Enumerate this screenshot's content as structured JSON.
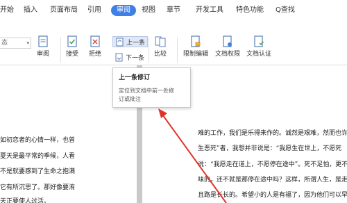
{
  "menu": {
    "items": [
      "开始",
      "插入",
      "页面布局",
      "引用",
      "审阅",
      "视图",
      "章节",
      "开发工具",
      "特色功能"
    ],
    "active": "审阅",
    "search_label": "Q查找"
  },
  "ribbon": {
    "combo_text": "态",
    "review_label": "审阅",
    "accept_label": "接受",
    "reject_label": "拒绝",
    "prev_label": "上一条",
    "next_label": "下一条",
    "compare_label": "比较",
    "restrict_label": "限制编辑",
    "permission_label": "文档权限",
    "certify_label": "文档认证"
  },
  "tooltip": {
    "title": "上一条修订",
    "description_line1": "定位到文档中前一处修",
    "description_line2": "订或批注"
  },
  "document": {
    "left_lines": [
      "如初恋者的心情一样，也曾",
      "夏天是最平常的季候，人看",
      "不是就要感到了生命之抱满",
      "它有所沉思了。那好像要洧",
      "天正要使人过活。"
    ],
    "right_lines": [
      "难的工作，我们是乐得来作的。诚然是艰难，然而也许",
      "生恶死”者，我想并非说是：“我愿生在世上，不愿死",
      "说：“我愿走在道上，不愿停在途中”。死不足怕，更不",
      "味的，还不就是那停在途中吗？这样，所谓人生，是走",
      "且路是长长的。希望小的人是有福了，因为他们可以早"
    ]
  },
  "colors": {
    "accent": "#3f80e8",
    "annotation_arrow": "#e0332b"
  }
}
